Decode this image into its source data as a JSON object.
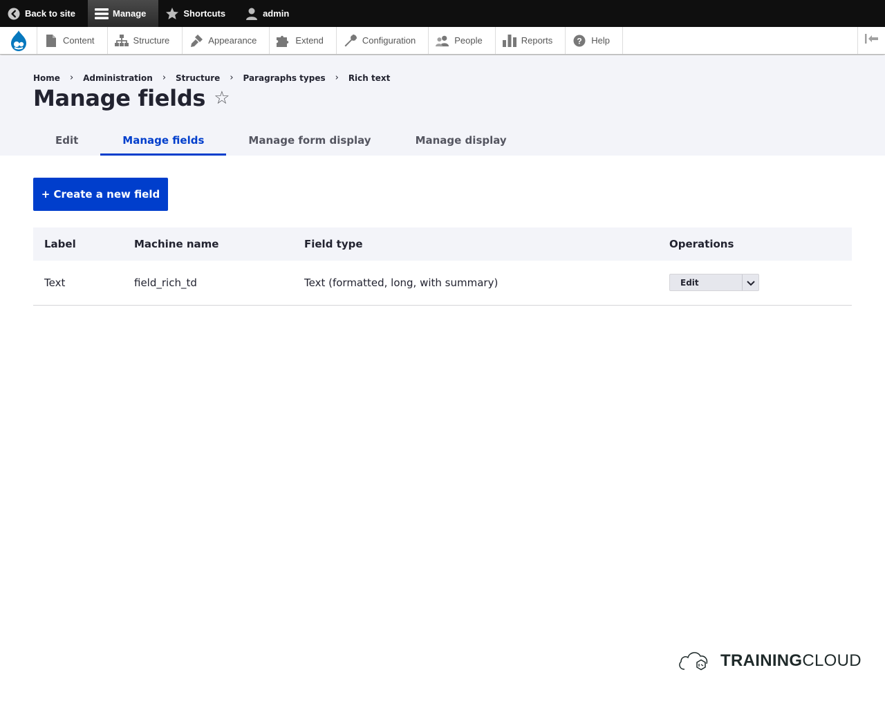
{
  "toolbar": {
    "back_label": "Back to site",
    "manage_label": "Manage",
    "shortcuts_label": "Shortcuts",
    "user_label": "admin"
  },
  "tray": {
    "items": [
      {
        "label": "Content",
        "icon": "file-icon"
      },
      {
        "label": "Structure",
        "icon": "sitemap-icon"
      },
      {
        "label": "Appearance",
        "icon": "paintbrush-icon"
      },
      {
        "label": "Extend",
        "icon": "puzzle-icon"
      },
      {
        "label": "Configuration",
        "icon": "wrench-icon"
      },
      {
        "label": "People",
        "icon": "people-icon"
      },
      {
        "label": "Reports",
        "icon": "bar-chart-icon"
      },
      {
        "label": "Help",
        "icon": "help-icon"
      }
    ]
  },
  "breadcrumb": [
    "Home",
    "Administration",
    "Structure",
    "Paragraphs types",
    "Rich text"
  ],
  "page": {
    "title": "Manage fields",
    "star": "☆"
  },
  "tabs": [
    {
      "label": "Edit",
      "active": false
    },
    {
      "label": "Manage fields",
      "active": true
    },
    {
      "label": "Manage form display",
      "active": false
    },
    {
      "label": "Manage display",
      "active": false
    }
  ],
  "actions": {
    "create_label": "+ Create a new field"
  },
  "table": {
    "headers": [
      "Label",
      "Machine name",
      "Field type",
      "Operations"
    ],
    "rows": [
      {
        "label": "Text",
        "machine_name": "field_rich_td",
        "field_type": "Text (formatted, long, with summary)",
        "operation": "Edit"
      }
    ]
  },
  "watermark": {
    "brand_bold": "TRAINING",
    "brand_light": "CLOUD"
  },
  "colors": {
    "toolbar_bg": "#0f0f0f",
    "accent": "#003ecc",
    "header_bg": "#f3f4f9",
    "drupal_blue": "#0678be"
  }
}
